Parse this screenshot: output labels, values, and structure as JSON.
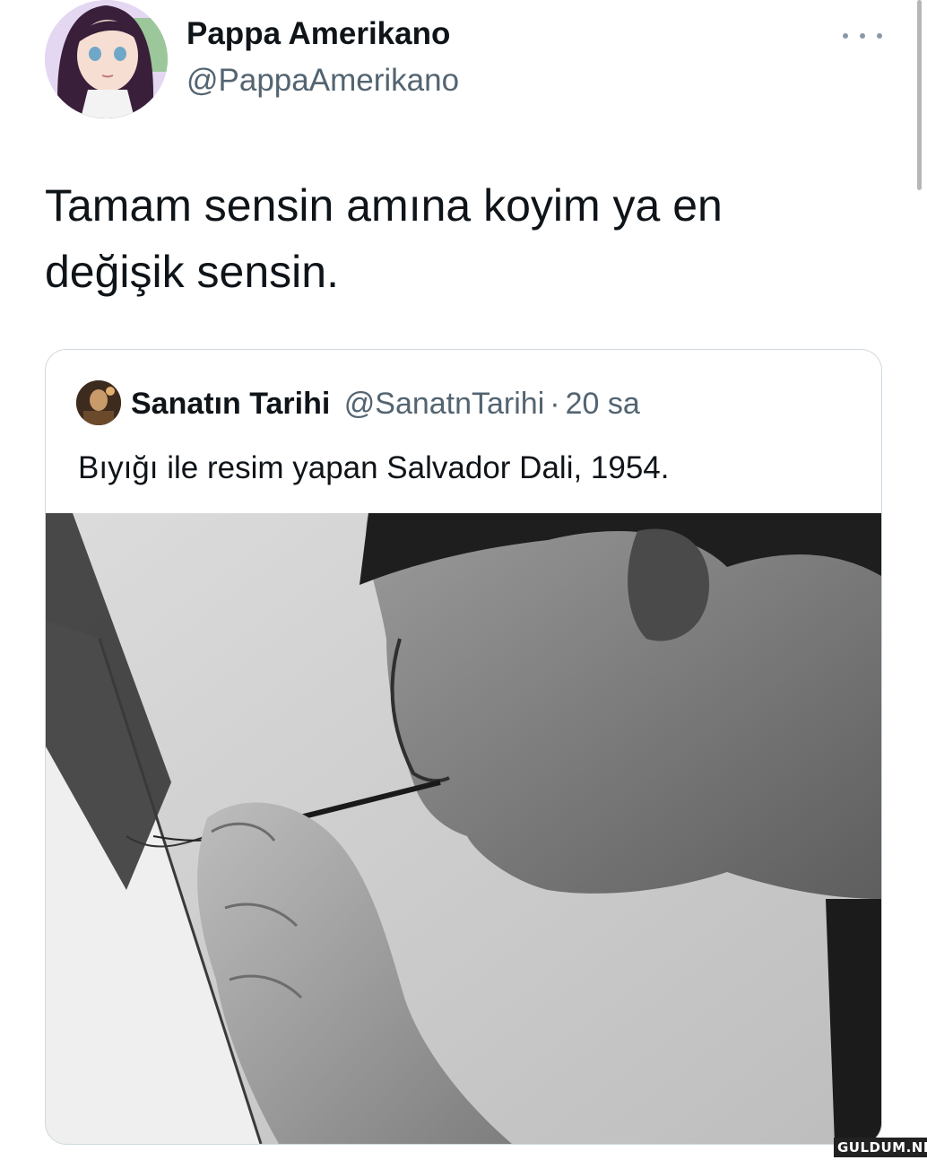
{
  "tweet": {
    "display_name": "Pappa Amerikano",
    "handle": "@PappaAmerikano",
    "text": "Tamam sensin amına koyim ya en değişik sensin.",
    "more_icon": "more-horizontal-icon"
  },
  "quote": {
    "display_name": "Sanatın Tarihi",
    "handle": "@SanatnTarihi",
    "separator": "·",
    "time": "20 sa",
    "text": "Bıyığı ile resim yapan Salvador Dali, 1954."
  },
  "watermark": "GULDUM.NET",
  "colors": {
    "text_primary": "#0f1419",
    "text_secondary": "#536471",
    "card_border": "#cfd9de"
  }
}
